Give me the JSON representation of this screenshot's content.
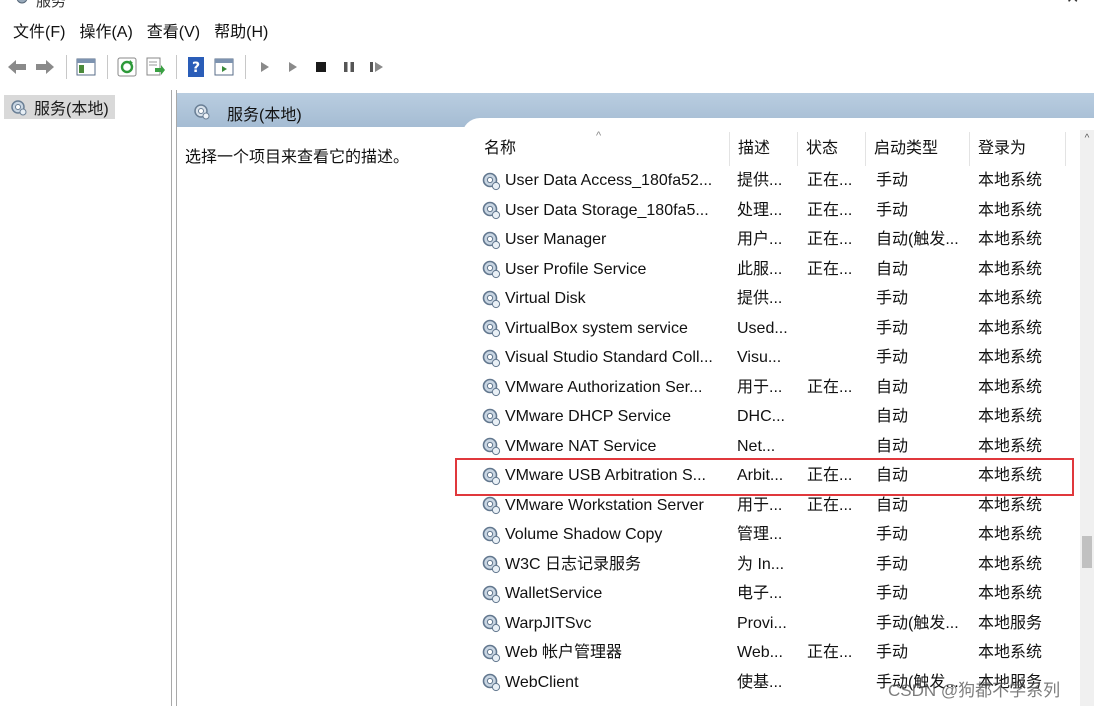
{
  "window": {
    "title": "服务"
  },
  "menu": {
    "items": [
      "文件(F)",
      "操作(A)",
      "查看(V)",
      "帮助(H)"
    ]
  },
  "toolbar": {
    "buttons": [
      "back-icon",
      "forward-icon",
      "show-hide-tree-icon",
      "refresh-icon",
      "export-list-icon",
      "help-icon",
      "properties-icon",
      "start-icon",
      "start-alt-icon",
      "stop-icon",
      "pause-icon",
      "restart-icon"
    ]
  },
  "tree": {
    "root_label": "服务(本地)"
  },
  "panel": {
    "title": "服务(本地)",
    "description_prompt": "选择一个项目来查看它的描述。"
  },
  "columns": {
    "name": "名称",
    "description": "描述",
    "status": "状态",
    "startup": "启动类型",
    "logon": "登录为"
  },
  "services": [
    {
      "name": "User Data Access_180fa52...",
      "description": "提供...",
      "status": "正在...",
      "startup": "手动",
      "logon": "本地系统"
    },
    {
      "name": "User Data Storage_180fa5...",
      "description": "处理...",
      "status": "正在...",
      "startup": "手动",
      "logon": "本地系统"
    },
    {
      "name": "User Manager",
      "description": "用户...",
      "status": "正在...",
      "startup": "自动(触发...",
      "logon": "本地系统"
    },
    {
      "name": "User Profile Service",
      "description": "此服...",
      "status": "正在...",
      "startup": "自动",
      "logon": "本地系统"
    },
    {
      "name": "Virtual Disk",
      "description": "提供...",
      "status": "",
      "startup": "手动",
      "logon": "本地系统"
    },
    {
      "name": "VirtualBox system service",
      "description": "Used...",
      "status": "",
      "startup": "手动",
      "logon": "本地系统"
    },
    {
      "name": "Visual Studio Standard Coll...",
      "description": "Visu...",
      "status": "",
      "startup": "手动",
      "logon": "本地系统"
    },
    {
      "name": "VMware Authorization Ser...",
      "description": "用于...",
      "status": "正在...",
      "startup": "自动",
      "logon": "本地系统"
    },
    {
      "name": "VMware DHCP Service",
      "description": "DHC...",
      "status": "",
      "startup": "自动",
      "logon": "本地系统"
    },
    {
      "name": "VMware NAT Service",
      "description": "Net...",
      "status": "",
      "startup": "自动",
      "logon": "本地系统"
    },
    {
      "name": "VMware USB Arbitration S...",
      "description": "Arbit...",
      "status": "正在...",
      "startup": "自动",
      "logon": "本地系统"
    },
    {
      "name": "VMware Workstation Server",
      "description": "用于...",
      "status": "正在...",
      "startup": "自动",
      "logon": "本地系统"
    },
    {
      "name": "Volume Shadow Copy",
      "description": "管理...",
      "status": "",
      "startup": "手动",
      "logon": "本地系统"
    },
    {
      "name": "W3C 日志记录服务",
      "description": "为 In...",
      "status": "",
      "startup": "手动",
      "logon": "本地系统"
    },
    {
      "name": "WalletService",
      "description": "电子...",
      "status": "",
      "startup": "手动",
      "logon": "本地系统"
    },
    {
      "name": "WarpJITSvc",
      "description": "Provi...",
      "status": "",
      "startup": "手动(触发...",
      "logon": "本地服务"
    },
    {
      "name": "Web 帐户管理器",
      "description": "Web...",
      "status": "正在...",
      "startup": "手动",
      "logon": "本地系统"
    },
    {
      "name": "WebClient",
      "description": "使基...",
      "status": "",
      "startup": "手动(触发...",
      "logon": "本地服务"
    }
  ],
  "watermark": "CSDN @狗都不学系列",
  "colors": {
    "header_band": "#a5bcd3",
    "highlight_border": "#e0383c",
    "selection": "#d9d9d9"
  }
}
